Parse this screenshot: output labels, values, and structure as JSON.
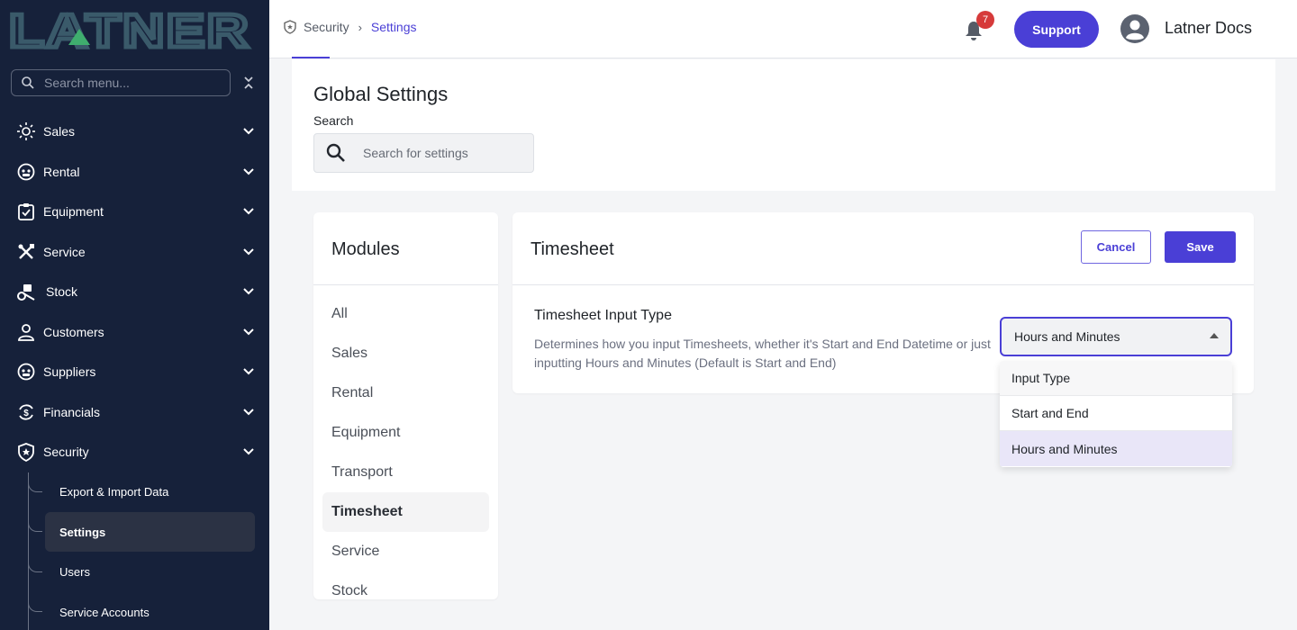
{
  "app": {
    "brand": "LATNER",
    "brand_color": "#3a5a6a",
    "accent": "#4a3fd6"
  },
  "sidebar": {
    "search_placeholder": "Search menu...",
    "items": [
      {
        "label": "Sales",
        "icon": "sun-radiate-icon"
      },
      {
        "label": "Rental",
        "icon": "robot-face-icon"
      },
      {
        "label": "Equipment",
        "icon": "clipboard-check-icon"
      },
      {
        "label": "Service",
        "icon": "tools-icon"
      },
      {
        "label": "Stock",
        "icon": "forklift-icon"
      },
      {
        "label": "Customers",
        "icon": "person-icon"
      },
      {
        "label": "Suppliers",
        "icon": "robot-face-icon"
      },
      {
        "label": "Financials",
        "icon": "dollar-cycle-icon"
      },
      {
        "label": "Security",
        "icon": "shield-icon"
      }
    ],
    "sub_items": [
      {
        "label": "Export & Import Data"
      },
      {
        "label": "Settings"
      },
      {
        "label": "Users"
      },
      {
        "label": "Service Accounts"
      }
    ]
  },
  "topbar": {
    "breadcrumb": [
      "Security",
      "Settings"
    ],
    "notification_count": "7",
    "support_label": "Support",
    "user_name": "Latner Docs"
  },
  "header": {
    "title": "Global Settings",
    "search_label": "Search",
    "search_placeholder": "Search for settings"
  },
  "modules": {
    "title": "Modules",
    "items": [
      "All",
      "Sales",
      "Rental",
      "Equipment",
      "Transport",
      "Timesheet",
      "Service",
      "Stock"
    ],
    "active": "Timesheet"
  },
  "timesheet": {
    "title": "Timesheet",
    "cancel_label": "Cancel",
    "save_label": "Save",
    "field_title": "Timesheet Input Type",
    "field_description": "Determines how you input Timesheets, whether it's Start and End Datetime or just inputting Hours and Minutes (Default is Start and End)",
    "selected_value": "Hours and Minutes",
    "options": [
      "Input Type",
      "Start and End",
      "Hours and Minutes"
    ]
  }
}
